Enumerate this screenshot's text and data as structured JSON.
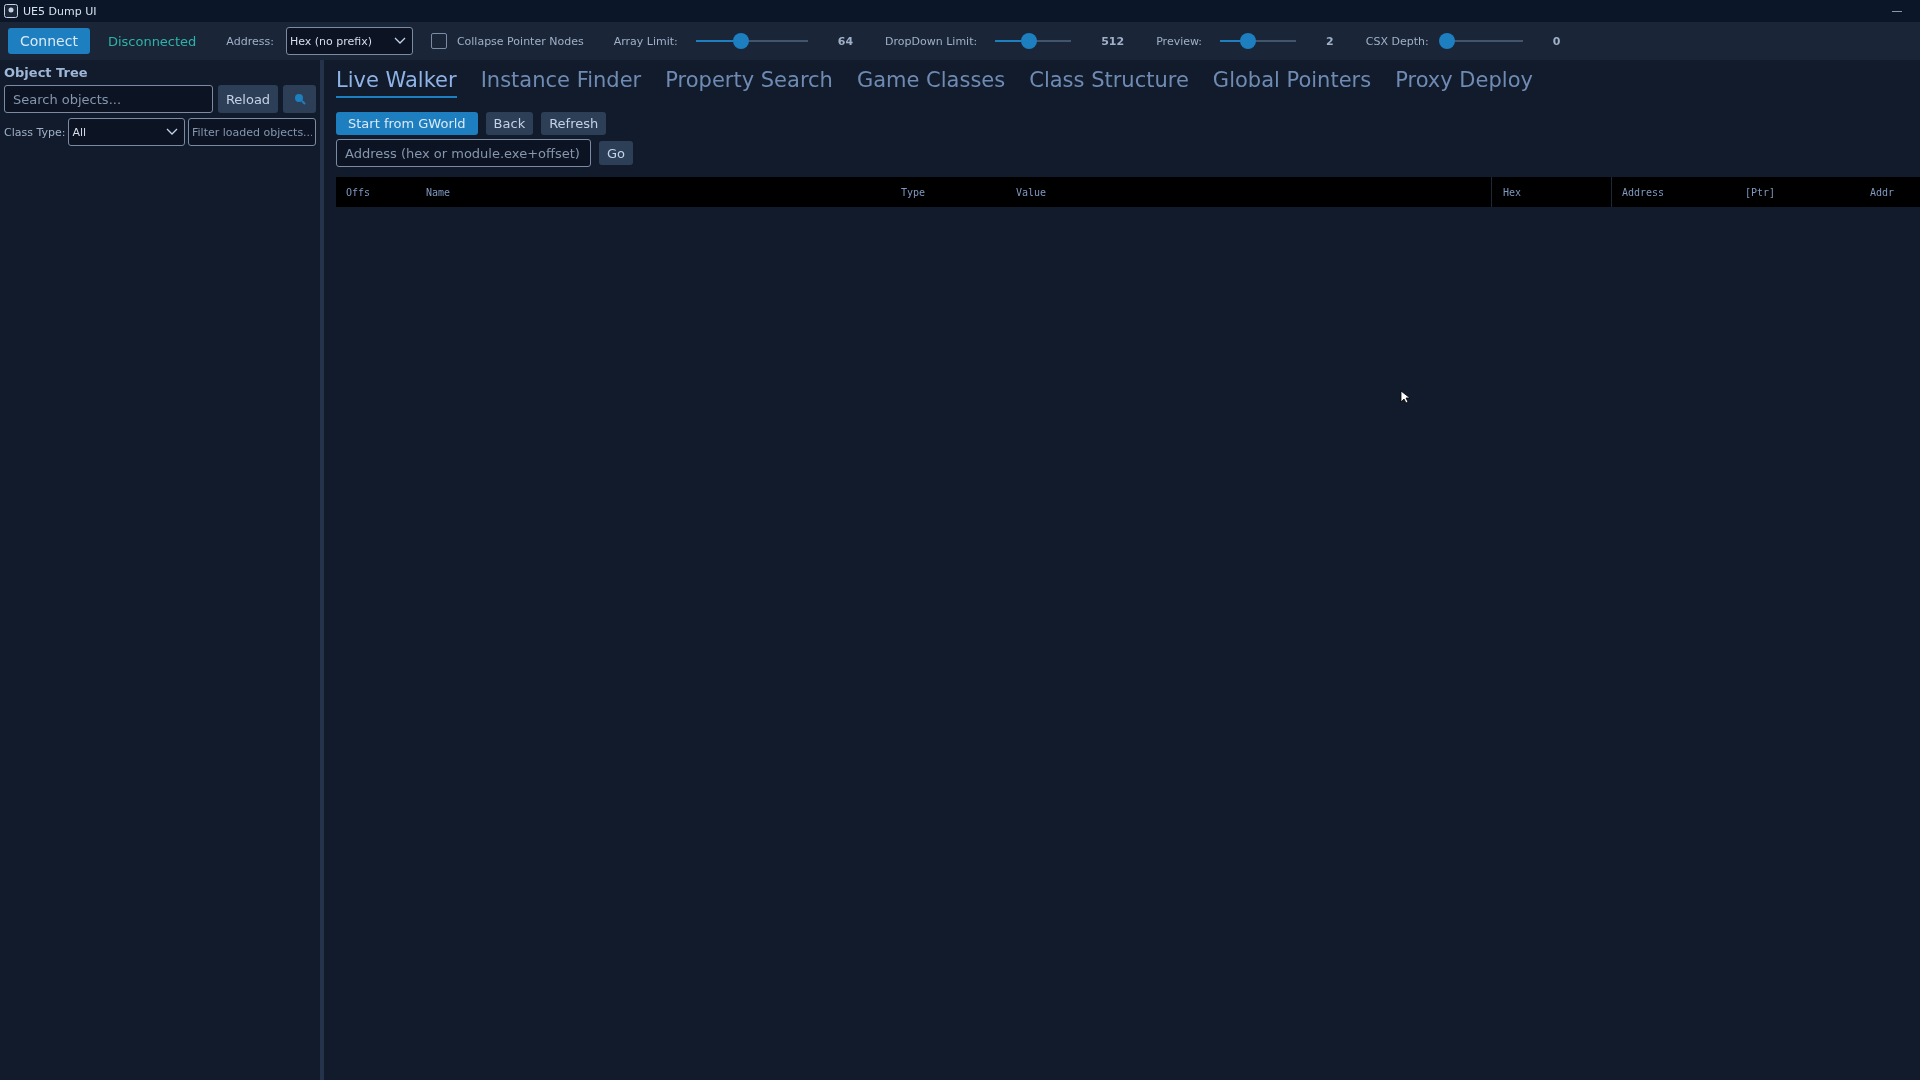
{
  "window": {
    "title": "UE5 Dump UI"
  },
  "toolbar": {
    "connect_button": "Connect",
    "status": "Disconnected",
    "address_label": "Address:",
    "address_format": "Hex (no prefix)",
    "collapse": {
      "label": "Collapse Pointer Nodes",
      "checked": false
    },
    "sliders": [
      {
        "label": "Array Limit:",
        "level": 0.4,
        "reading": "64"
      },
      {
        "label": "DropDown Limit:",
        "level": 0.45,
        "reading": "512"
      },
      {
        "label": "Preview:",
        "level": 0.37,
        "reading": "2"
      },
      {
        "label": "CSX Depth:",
        "level": 0,
        "reading": "0"
      }
    ]
  },
  "sidebar": {
    "title": "Object Tree",
    "search": {
      "placeholder": "Search objects..."
    },
    "reload_button": "Reload",
    "class_type_label": "Class Type:",
    "class_type": "All",
    "filter": {
      "placeholder": "Filter loaded objects..."
    }
  },
  "tabs": [
    {
      "label": "Live Walker",
      "selected": true
    },
    {
      "label": "Instance Finder",
      "selected": false
    },
    {
      "label": "Property Search",
      "selected": false
    },
    {
      "label": "Game Classes",
      "selected": false
    },
    {
      "label": "Class Structure",
      "selected": false
    },
    {
      "label": "Global Pointers",
      "selected": false
    },
    {
      "label": "Proxy Deploy",
      "selected": false
    }
  ],
  "actions": [
    {
      "label": "Start from GWorld",
      "kind": "primary"
    },
    {
      "label": "Back",
      "kind": "secondary"
    },
    {
      "label": "Refresh",
      "kind": "secondary"
    }
  ],
  "address_field": {
    "placeholder": "Address (hex or module.exe+offset)"
  },
  "go_button": "Go",
  "table": {
    "columns": [
      "Offs",
      "Name",
      "Type",
      "Value",
      "Hex",
      "Address",
      "[Ptr]",
      "Addr"
    ]
  }
}
